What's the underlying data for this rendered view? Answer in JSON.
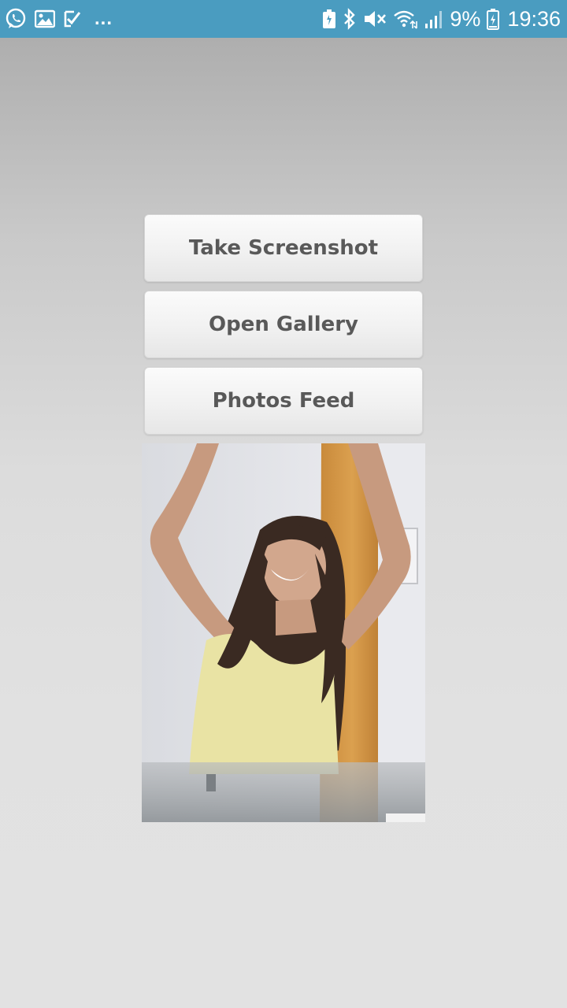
{
  "status_bar": {
    "left_icons": [
      "whatsapp-icon",
      "gallery-notification-icon",
      "task-check-icon"
    ],
    "overflow": "...",
    "right_icons": [
      "battery-saver-icon",
      "bluetooth-icon",
      "mute-icon",
      "wifi-icon",
      "cell-signal-icon",
      "battery-icon"
    ],
    "battery_percent": "9%",
    "time": "19:36",
    "background_color": "#4a9cc0"
  },
  "buttons": {
    "take_screenshot": "Take Screenshot",
    "open_gallery": "Open Gallery",
    "photos_feed": "Photos Feed",
    "text_color": "#595959"
  },
  "photo": {
    "description_icon": "photo-preview"
  }
}
